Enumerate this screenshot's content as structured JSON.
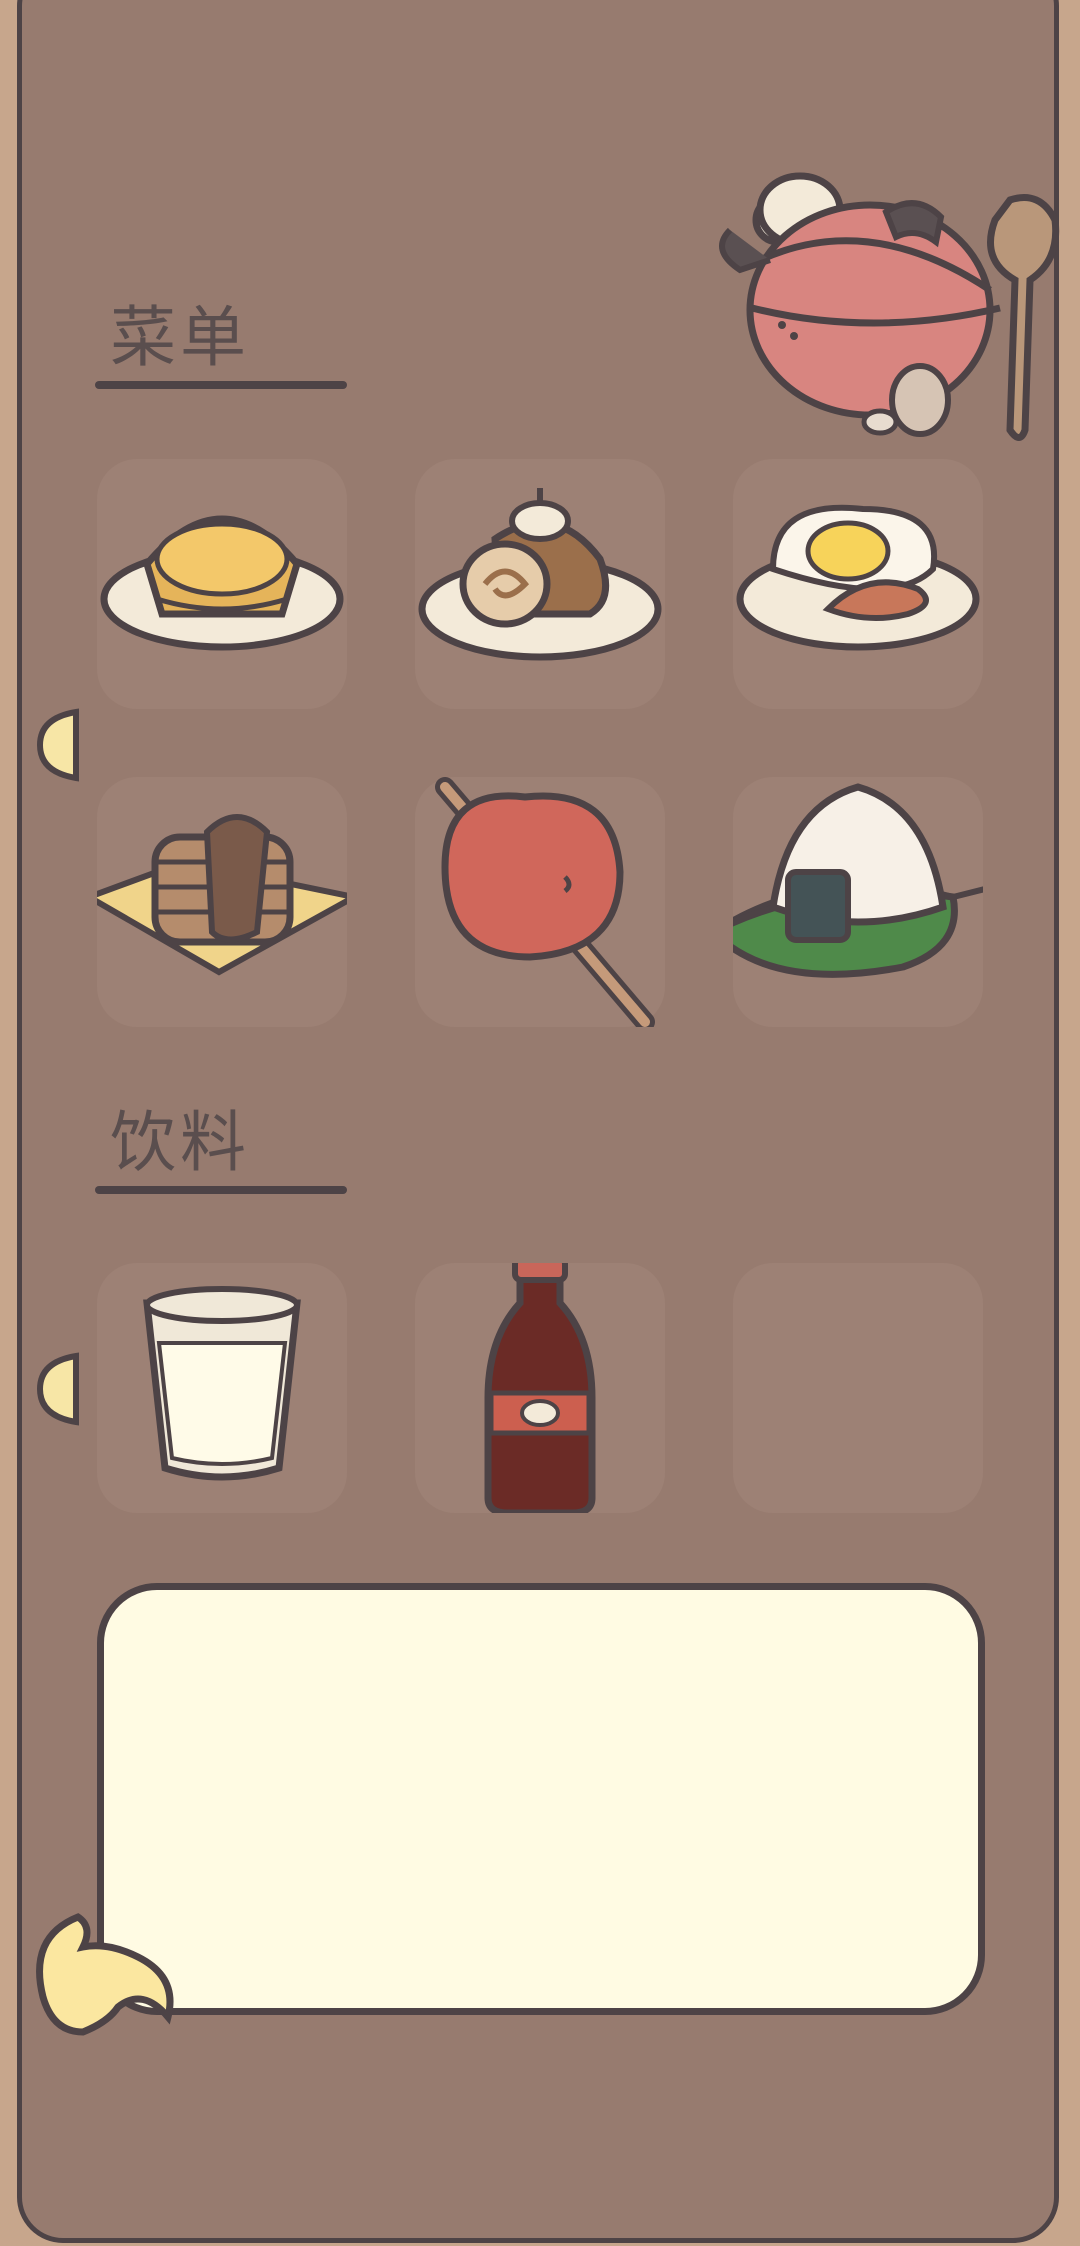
{
  "menu": {
    "title": "菜单"
  },
  "drinks": {
    "title": "饮料"
  },
  "food_items": [
    {
      "icon": "egg-tart-icon"
    },
    {
      "icon": "swiss-roll-icon"
    },
    {
      "icon": "fried-egg-icon"
    },
    {
      "icon": "pancake-stack-icon"
    },
    {
      "icon": "candy-apple-icon"
    },
    {
      "icon": "onigiri-icon"
    }
  ],
  "drink_items": [
    {
      "icon": "milk-glass-icon"
    },
    {
      "icon": "cola-bottle-icon"
    },
    {
      "icon": "empty-slot"
    }
  ],
  "dialog": {
    "text": ""
  },
  "colors": {
    "panel": "#977b6f",
    "outline": "#4d4346",
    "slot": "#9d8175",
    "bubble": "#fffbe3"
  }
}
